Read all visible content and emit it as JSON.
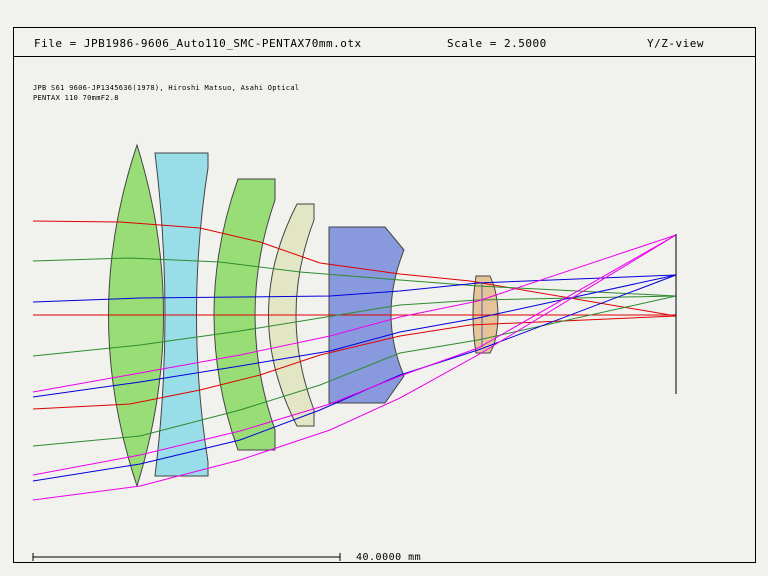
{
  "header": {
    "file": "File = JPB1986-9606_Auto110_SMC-PENTAX70mm.otx",
    "scale": "Scale = 2.5000",
    "view": "Y/Z-view"
  },
  "notes": [
    "JPB S61 9606-JP1345636(1978), Hiroshi Matsuo, Asahi Optical",
    "PENTAX 110 70mmF2.8"
  ],
  "scale_bar": {
    "label": "40.0000 mm"
  },
  "colors": {
    "lens_green": "#99dd77",
    "lens_cyan": "#99dde8",
    "lens_cream": "#e3e6c4",
    "lens_blue": "#8899dd",
    "lens_orange": "#e6c49a",
    "ray_red": "#e00000",
    "ray_green": "#2e8b2e",
    "ray_blue": "#0000dd",
    "ray_magenta": "#ee00ee"
  }
}
